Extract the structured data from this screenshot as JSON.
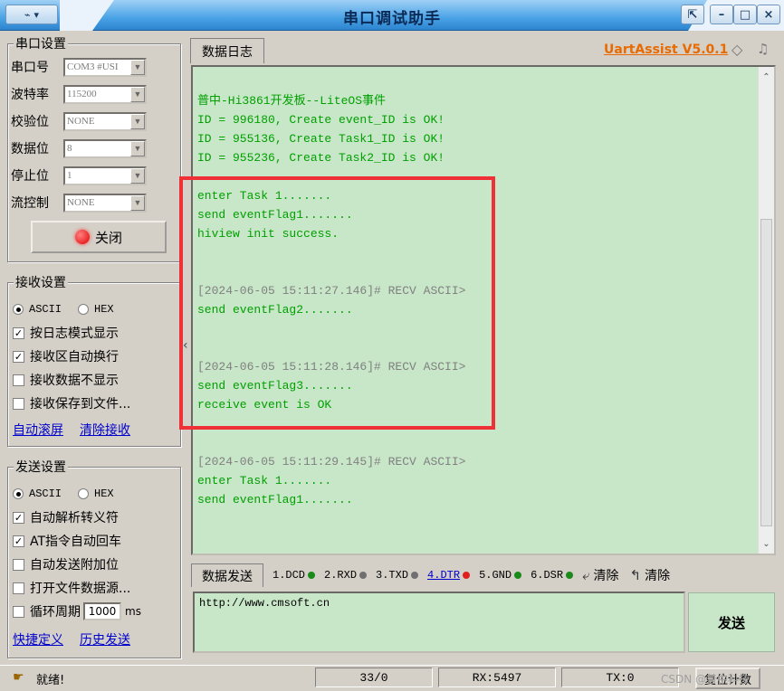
{
  "window": {
    "title": "串口调试助手",
    "menu_icon": "serial-port-icon",
    "minimize": "–",
    "maximize": "□",
    "close": "×"
  },
  "serial_settings": {
    "legend": "串口设置",
    "port_label": "串口号",
    "port_value": "COM3 #USI",
    "baud_label": "波特率",
    "baud_value": "115200",
    "parity_label": "校验位",
    "parity_value": "NONE",
    "databits_label": "数据位",
    "databits_value": "8",
    "stopbits_label": "停止位",
    "stopbits_value": "1",
    "flow_label": "流控制",
    "flow_value": "NONE",
    "close_button": "关闭"
  },
  "receive_settings": {
    "legend": "接收设置",
    "ascii": "ASCII",
    "hex": "HEX",
    "opt1": "按日志模式显示",
    "opt2": "接收区自动换行",
    "opt3": "接收数据不显示",
    "opt4": "接收保存到文件...",
    "link1": "自动滚屏",
    "link2": "清除接收"
  },
  "send_settings": {
    "legend": "发送设置",
    "ascii": "ASCII",
    "hex": "HEX",
    "opt1": "自动解析转义符",
    "opt2": "AT指令自动回车",
    "opt3": "自动发送附加位",
    "opt4": "打开文件数据源...",
    "opt5": "循环周期",
    "period_value": "1000",
    "period_unit": "ms",
    "link1": "快捷定义",
    "link2": "历史发送"
  },
  "log": {
    "tab": "数据日志",
    "brand": "UartAssist V5.0.1",
    "lines": [
      "普中-Hi3861开发板--LiteOS事件",
      "ID = 996180, Create event_ID is OK!",
      "ID = 955136, Create Task1_ID is OK!",
      "ID = 955236, Create Task2_ID is OK!",
      "",
      "enter Task 1.......",
      "send eventFlag1.......",
      "hiview init success.",
      "",
      "",
      "[2024-06-05 15:11:27.146]# RECV ASCII>",
      "send eventFlag2.......",
      "",
      "",
      "[2024-06-05 15:11:28.146]# RECV ASCII>",
      "send eventFlag3.......",
      "receive event is OK",
      "",
      "",
      "[2024-06-05 15:11:29.145]# RECV ASCII>",
      "enter Task 1.......",
      "send eventFlag1......."
    ],
    "line_colors": [
      "#00a000",
      "#00a000",
      "#00a000",
      "#00a000",
      "#00a000",
      "#00a000",
      "#00a000",
      "#00a000",
      "#808080",
      "#808080",
      "#808080",
      "#00a000",
      "#808080",
      "#808080",
      "#808080",
      "#00a000",
      "#00a000",
      "#808080",
      "#808080",
      "#808080",
      "#00a000",
      "#00a000"
    ]
  },
  "send": {
    "tab": "数据发送",
    "signals": [
      {
        "label": "1.DCD",
        "color": "#1a8a1a"
      },
      {
        "label": "2.RXD",
        "color": "#707070"
      },
      {
        "label": "3.TXD",
        "color": "#707070"
      },
      {
        "label": "4.DTR",
        "color": "#e02020"
      },
      {
        "label": "5.GND",
        "color": "#1a8a1a"
      },
      {
        "label": "6.DSR",
        "color": "#1a8a1a"
      }
    ],
    "clear1": "清除",
    "clear2": "清除",
    "input_value": "http://www.cmsoft.cn",
    "send_button": "发送"
  },
  "status": {
    "ready": "就绪!",
    "count": "33/0",
    "rx": "RX:5497",
    "tx": "TX:0",
    "reset": "复位计数",
    "watermark": "CSDN @普中科技"
  }
}
